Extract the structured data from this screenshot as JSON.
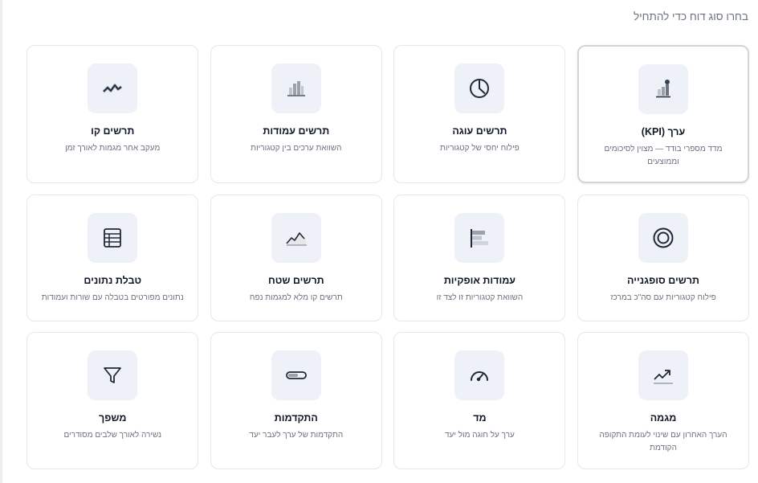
{
  "header": {
    "title": "בחרו סוג דוח כדי להתחיל"
  },
  "cards": [
    {
      "icon": "kpi-icon",
      "title": "ערך (KPI)",
      "desc": "מדד מספרי בודד — מצוין לסיכומים וממוצעים"
    },
    {
      "icon": "pie-chart-icon",
      "title": "תרשים עוגה",
      "desc": "פילוח יחסי של קטגוריות"
    },
    {
      "icon": "bar-chart-icon",
      "title": "תרשים עמודות",
      "desc": "השוואת ערכים בין קטגוריות"
    },
    {
      "icon": "line-chart-icon",
      "title": "תרשים קו",
      "desc": "מעקב אחר מגמות לאורך זמן"
    },
    {
      "icon": "donut-chart-icon",
      "title": "תרשים סופגנייה",
      "desc": "פילוח קטגוריות עם סה\"כ במרכז"
    },
    {
      "icon": "horizontal-bars-icon",
      "title": "עמודות אופקיות",
      "desc": "השוואת קטגוריות זו לצד זו"
    },
    {
      "icon": "area-chart-icon",
      "title": "תרשים שטח",
      "desc": "תרשים קו מלא למגמות נפח"
    },
    {
      "icon": "table-icon",
      "title": "טבלת נתונים",
      "desc": "נתונים מפורטים בטבלה עם שורות ועמודות"
    },
    {
      "icon": "trend-icon",
      "title": "מגמה",
      "desc": "הערך האחרון עם שינוי לעומת התקופה הקודמת"
    },
    {
      "icon": "gauge-icon",
      "title": "מד",
      "desc": "ערך על חוגה מול יעד"
    },
    {
      "icon": "progress-bar-icon",
      "title": "התקדמות",
      "desc": "התקדמות של ערך לעבר יעד"
    },
    {
      "icon": "funnel-icon",
      "title": "משפך",
      "desc": "נשירה לאורך שלבים מסודרים"
    }
  ]
}
